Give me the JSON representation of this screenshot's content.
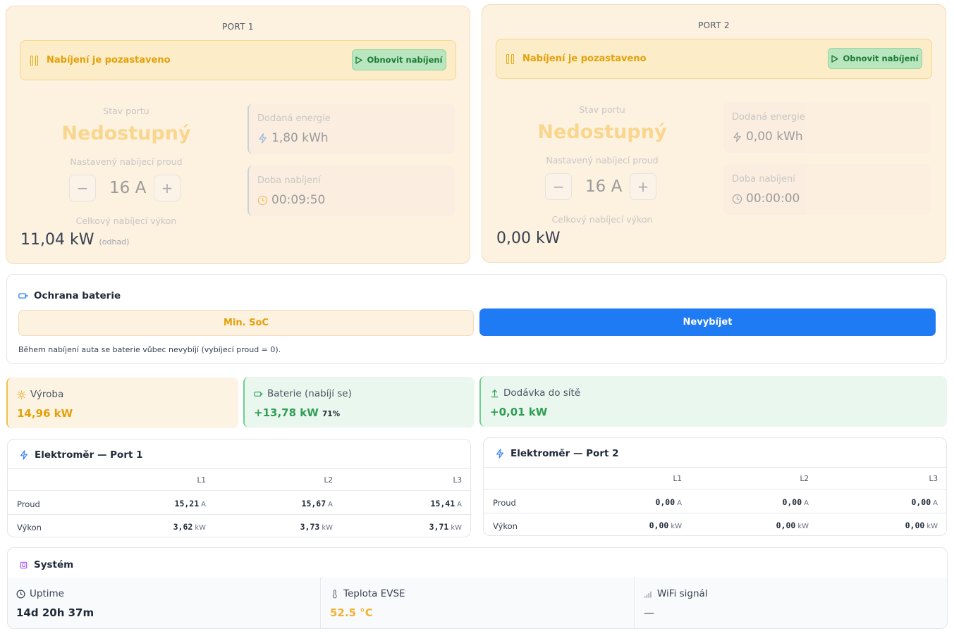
{
  "ports": [
    {
      "title": "PORT 1",
      "banner": "Nabíjení je pozastaveno",
      "resume_label": "Obnovit nabíjení",
      "state_label": "Stav portu",
      "state_value": "Nedostupný",
      "current_label": "Nastavený nabíjecí proud",
      "current_value": "16 A",
      "minus": "−",
      "plus": "+",
      "power_label": "Celkový nabíjecí výkon",
      "power_value": "11,04 kW",
      "power_note": "(odhad)",
      "energy_label": "Dodaná energie",
      "energy_value": "1,80 kWh",
      "duration_label": "Doba nabíjení",
      "duration_value": "00:09:50"
    },
    {
      "title": "PORT 2",
      "banner": "Nabíjení je pozastaveno",
      "resume_label": "Obnovit nabíjení",
      "state_label": "Stav portu",
      "state_value": "Nedostupný",
      "current_label": "Nastavený nabíjecí proud",
      "current_value": "16 A",
      "minus": "−",
      "plus": "+",
      "power_label": "Celkový nabíjecí výkon",
      "power_value": "0,00 kW",
      "power_note": "",
      "energy_label": "Dodaná energie",
      "energy_value": "0,00 kWh",
      "duration_label": "Doba nabíjení",
      "duration_value": "00:00:00"
    }
  ],
  "battery_protection": {
    "title": "Ochrana baterie",
    "option_min_soc": "Min. SoC",
    "option_no_discharge": "Nevybíjet",
    "selected": "Nevybíjet",
    "hint": "Během nabíjení auta se baterie vůbec nevybíjí (vybíjecí proud = 0)."
  },
  "stats": {
    "production": {
      "label": "Výroba",
      "value": "14,96 kW",
      "color": "#e3a008"
    },
    "battery": {
      "label": "Baterie (nabíjí se)",
      "value": "+13,78 kW",
      "extra": "71%",
      "color": "#2f9e54"
    },
    "grid": {
      "label": "Dodávka do sítě",
      "value": "+0,01 kW",
      "color": "#2f9e54"
    }
  },
  "meters": [
    {
      "title": "Elektroměr — Port 1",
      "columns": [
        "L1",
        "L2",
        "L3"
      ],
      "rows": [
        {
          "label": "Proud",
          "unit": "A",
          "values": [
            "15,21",
            "15,67",
            "15,41"
          ]
        },
        {
          "label": "Výkon",
          "unit": "kW",
          "values": [
            "3,62",
            "3,73",
            "3,71"
          ]
        }
      ]
    },
    {
      "title": "Elektroměr — Port 2",
      "columns": [
        "L1",
        "L2",
        "L3"
      ],
      "rows": [
        {
          "label": "Proud",
          "unit": "A",
          "values": [
            "0,00",
            "0,00",
            "0,00"
          ]
        },
        {
          "label": "Výkon",
          "unit": "kW",
          "values": [
            "0,00",
            "0,00",
            "0,00"
          ]
        }
      ]
    }
  ],
  "system": {
    "title": "Systém",
    "uptime": {
      "label": "Uptime",
      "value": "14d 20h 37m"
    },
    "temperature": {
      "label": "Teplota EVSE",
      "value": "52.5 °C",
      "color": "#f2b233"
    },
    "wifi": {
      "label": "WiFi signál",
      "value": "—"
    }
  },
  "colors": {
    "accent_blue": "#1e7bf4",
    "warning": "#e3a008",
    "success": "#2f9e54"
  }
}
